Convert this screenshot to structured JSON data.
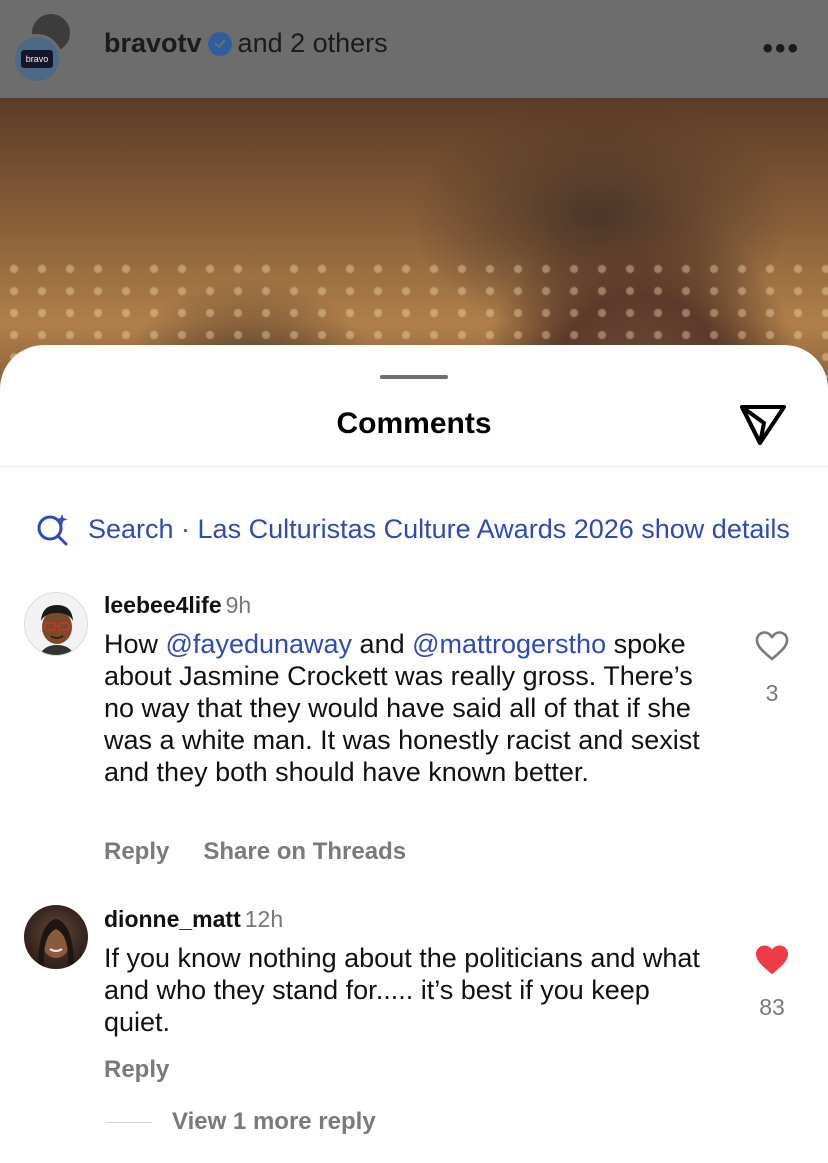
{
  "post": {
    "author": "bravotv",
    "coauthors": "and 2 others",
    "avatar_logo_text": "bravo"
  },
  "sheet": {
    "title": "Comments",
    "search_text": "Search · Las Culturistas Culture Awards 2026 show details"
  },
  "comments": [
    {
      "username": "leebee4life",
      "time": "9h",
      "text_parts": [
        "How ",
        "@fayedunaway",
        " and ",
        "@mattrogerstho",
        " spoke about Jasmine Crockett was really gross. There’s no way that they would have said all of that if she was a white man. It was honestly racist and sexist and they both should have known better."
      ],
      "likes": "3",
      "liked": false,
      "actions": [
        "Reply",
        "Share on Threads"
      ]
    },
    {
      "username": "dionne_matt",
      "time": "12h",
      "text": "If you know nothing about the politicians and what and who they stand for..... it’s best if you keep quiet.",
      "likes": "83",
      "liked": true,
      "actions": [
        "Reply"
      ]
    }
  ],
  "view_more_text": "View 1 more reply",
  "colors": {
    "link": "#2f4ab8",
    "like_active": "#ee3b48",
    "muted": "#7a7a7a"
  }
}
